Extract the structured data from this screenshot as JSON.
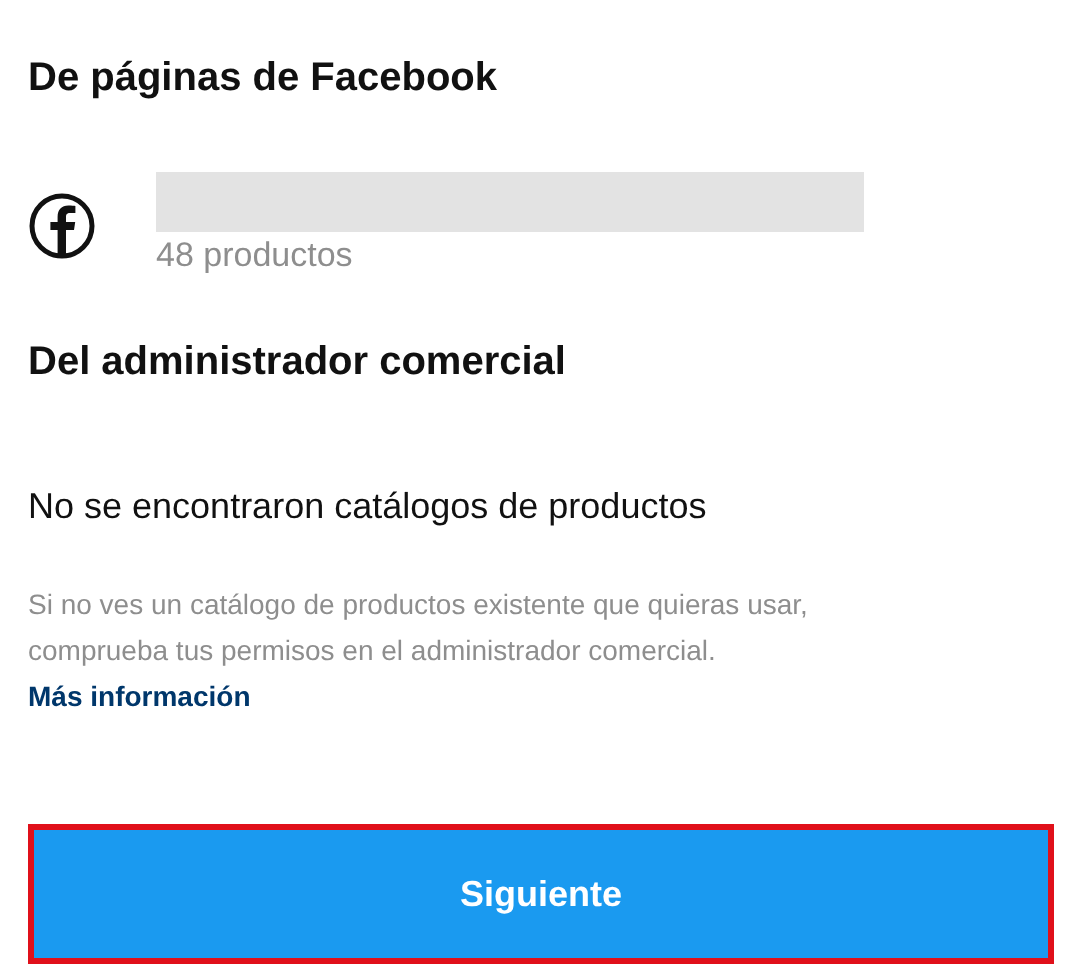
{
  "sections": [
    {
      "title": "De páginas de Facebook",
      "kind": "pages",
      "items": [
        {
          "subtitle": "48 productos"
        }
      ]
    },
    {
      "title": "Del administrador comercial",
      "kind": "empty",
      "message": "No se encontraron catálogos de productos"
    }
  ],
  "help": {
    "text": "Si no ves un catálogo de productos existente que quieras usar, comprueba tus permisos en el administrador comercial.",
    "link": "Más información"
  },
  "button": {
    "label": "Siguiente"
  }
}
